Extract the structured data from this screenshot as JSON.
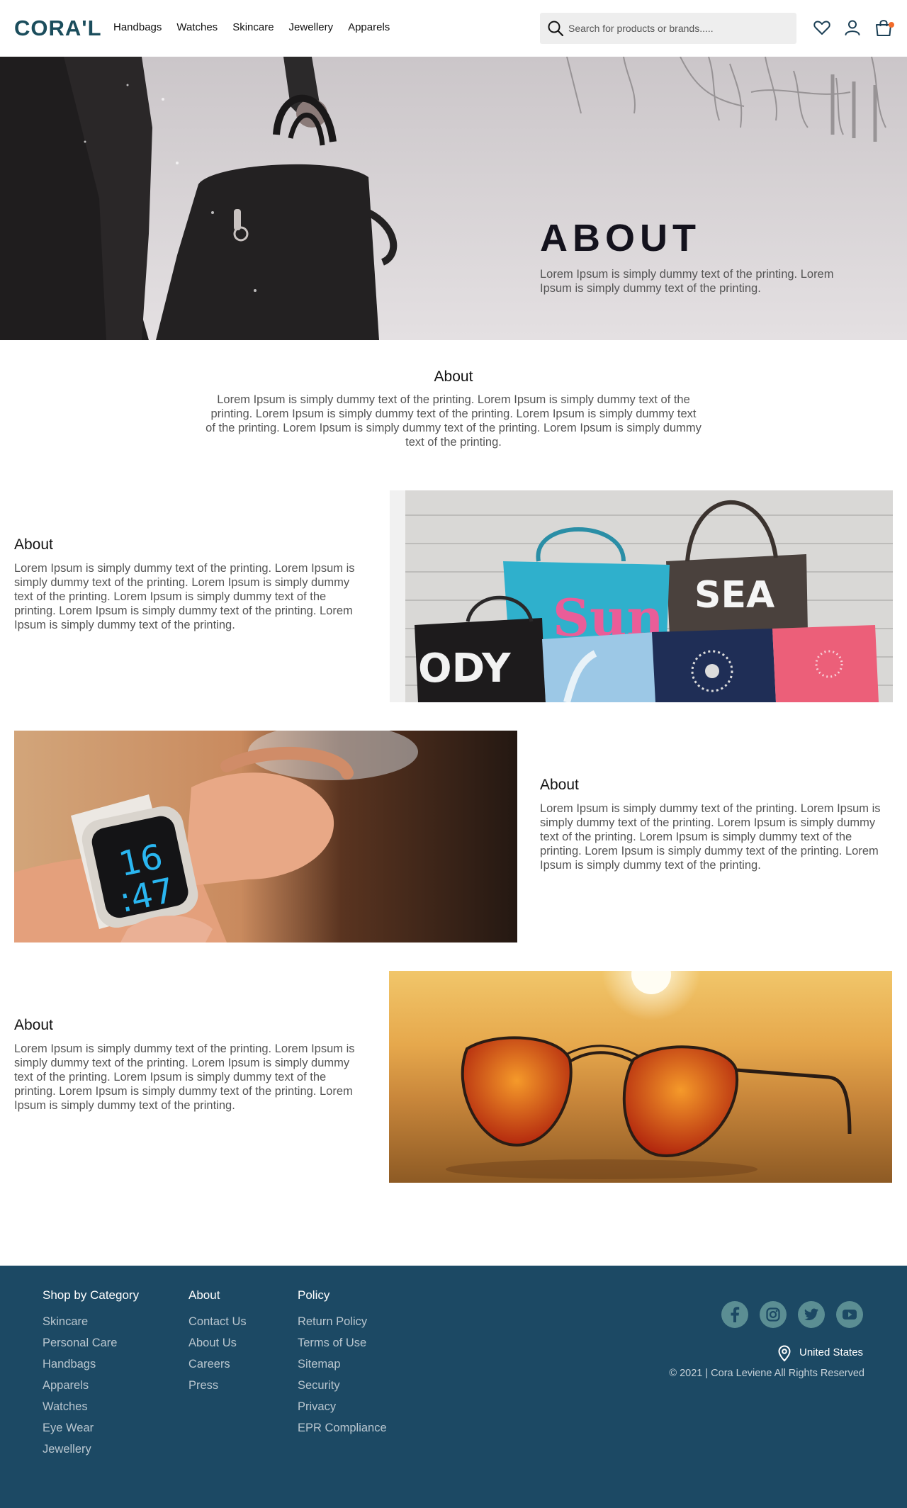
{
  "brand": {
    "logo": "CORA'L"
  },
  "nav": {
    "items": [
      "Handbags",
      "Watches",
      "Skincare",
      "Jewellery",
      "Apparels"
    ]
  },
  "search": {
    "placeholder": "Search for products or brands....."
  },
  "hero": {
    "title": "ABOUT",
    "text": "Lorem Ipsum is simply dummy text of the printing. Lorem Ipsum is simply dummy text of the printing."
  },
  "intro": {
    "title": "About",
    "text": "Lorem Ipsum is simply dummy text of the printing. Lorem Ipsum is simply dummy text of the printing.  Lorem Ipsum is simply dummy text of the printing. Lorem Ipsum is simply dummy text of the printing. Lorem Ipsum is simply dummy text of the printing. Lorem Ipsum is simply dummy text of the printing."
  },
  "features": [
    {
      "title": "About",
      "text": "Lorem Ipsum is simply dummy text of the printing. Lorem Ipsum is simply dummy text of the printing.  Lorem Ipsum is simply dummy text of the printing. Lorem Ipsum is simply dummy text of the printing. Lorem Ipsum is simply dummy text of the printing. Lorem Ipsum is simply dummy text of the printing.",
      "image": "handbags-photo"
    },
    {
      "title": "About",
      "text": "Lorem Ipsum is simply dummy text of the printing. Lorem Ipsum is simply dummy text of the printing.  Lorem Ipsum is simply dummy text of the printing. Lorem Ipsum is simply dummy text of the printing. Lorem Ipsum is simply dummy text of the printing. Lorem Ipsum is simply dummy text of the printing.",
      "image": "smartwatch-photo",
      "watch_hours": "16",
      "watch_minutes": ":47"
    },
    {
      "title": "About",
      "text": "Lorem Ipsum is simply dummy text of the printing. Lorem Ipsum is simply dummy text of the printing.  Lorem Ipsum is simply dummy text of the printing. Lorem Ipsum is simply dummy text of the printing. Lorem Ipsum is simply dummy text of the printing. Lorem Ipsum is simply dummy text of the printing.",
      "image": "sunglasses-photo"
    }
  ],
  "bag_prints": {
    "sun": "Sun",
    "sea": "SEA",
    "body": "ODY"
  },
  "footer": {
    "columns": [
      {
        "title": "Shop by Category",
        "links": [
          "Skincare",
          "Personal Care",
          "Handbags",
          "Apparels",
          "Watches",
          "Eye Wear",
          "Jewellery"
        ]
      },
      {
        "title": "About",
        "links": [
          "Contact Us",
          "About Us",
          "Careers",
          "Press"
        ]
      },
      {
        "title": "Policy",
        "links": [
          "Return Policy",
          "Terms of Use",
          "Sitemap",
          "Security",
          "Privacy",
          "EPR Compliance"
        ]
      }
    ],
    "social": [
      "facebook-icon",
      "instagram-icon",
      "twitter-icon",
      "youtube-icon"
    ],
    "country": "United States",
    "copyright": "© 2021 | Cora Leviene All Rights Reserved"
  },
  "colors": {
    "brand": "#1b4d5c",
    "footer_bg": "#1c4964",
    "social_bg": "#5b8e93",
    "cart_dot": "#f26b2a"
  }
}
